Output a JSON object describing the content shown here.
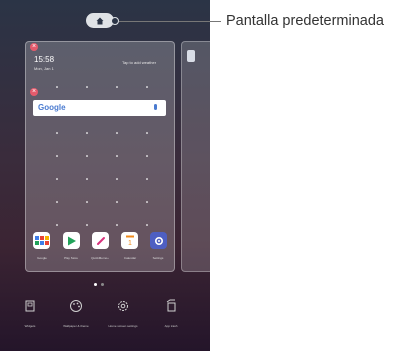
{
  "callout": {
    "label": "Pantalla predeterminada"
  },
  "home_page": {
    "clock": "15:58",
    "date": "Mon, Jan 1",
    "weather": "Tap to add weather",
    "search_logo": "Google"
  },
  "dock": {
    "apps": [
      {
        "label": "Google",
        "icon": "google-folder-icon",
        "color": "#3f7de8"
      },
      {
        "label": "Play Store",
        "icon": "play-store-icon",
        "color": "#22a35a"
      },
      {
        "label": "QuickMemo+",
        "icon": "quickmemo-icon",
        "color": "#d8307c"
      },
      {
        "label": "Calendar",
        "icon": "calendar-icon",
        "color": "#f08a1c"
      },
      {
        "label": "Settings",
        "icon": "settings-icon",
        "color": "#4e5fc2"
      }
    ]
  },
  "bottom_bar": {
    "items": [
      {
        "label": "Widgets",
        "icon": "widgets-icon"
      },
      {
        "label": "Wallpaper & theme",
        "icon": "palette-icon"
      },
      {
        "label": "Home screen settings",
        "icon": "gear-icon"
      },
      {
        "label": "App trash",
        "icon": "trash-icon"
      }
    ]
  },
  "colors": {
    "remove_badge": "#e45b6c",
    "indicator_active": "#ffffff",
    "indicator_inactive": "#8a8a8a"
  }
}
